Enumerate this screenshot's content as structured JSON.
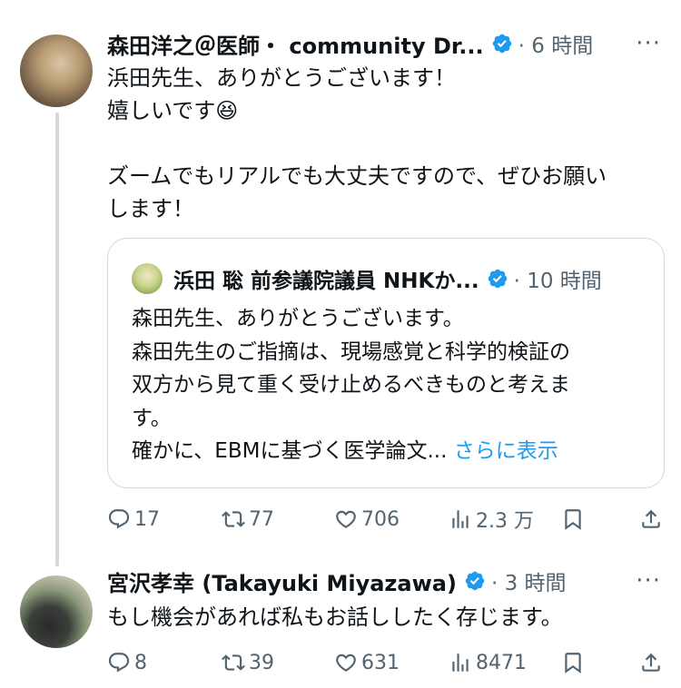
{
  "tweet1": {
    "author": "森田洋之＠医師・ community Dr...",
    "time": "6 時間",
    "more": "···",
    "body": [
      "浜田先生、ありがとうございます！",
      "嬉しいです😆",
      "",
      "ズームでもリアルでも大丈夫ですので、ぜひお願い",
      "します！"
    ],
    "quote": {
      "author": "浜田 聡 前参議院議員 NHKか...",
      "time": "10 時間",
      "body": [
        "森田先生、ありがとうございます。",
        "森田先生のご指摘は、現場感覚と科学的検証の",
        "双方から見て重く受け止めるべきものと考えま",
        "す。"
      ],
      "last_line": "確かに、EBMに基づく医学論文...",
      "show_more": "さらに表示"
    },
    "actions": {
      "replies": "17",
      "retweets": "77",
      "likes": "706",
      "views": "2.3 万"
    }
  },
  "tweet2": {
    "author": "宮沢孝幸 (Takayuki Miyazawa)",
    "time": "3 時間",
    "more": "···",
    "body": [
      "もし機会があれば私もお話ししたく存じます。"
    ],
    "actions": {
      "replies": "8",
      "retweets": "39",
      "likes": "631",
      "views": "8471"
    }
  },
  "icons": {
    "verified": "verified-badge-icon",
    "reply": "reply-icon",
    "retweet": "retweet-icon",
    "like": "heart-icon",
    "views": "views-icon",
    "bookmark": "bookmark-icon",
    "share": "share-icon"
  },
  "colors": {
    "verified": "#1d9bf0",
    "secondary_text": "#536471",
    "link": "#1d9bf0",
    "border": "#cfd9de"
  }
}
